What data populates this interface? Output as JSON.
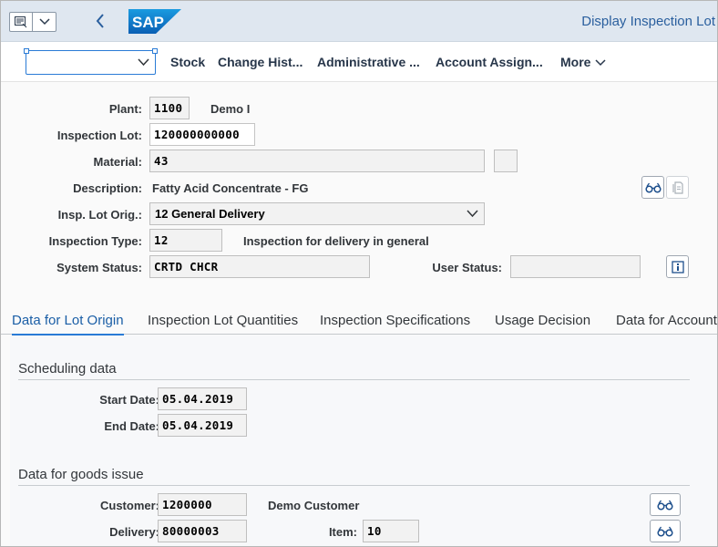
{
  "shell": {
    "title": "Display Inspection Lot",
    "logo_text": "SAP",
    "menu_icon": "menu-icon",
    "dropdown_icon": "chevron-down-icon",
    "back_icon": "back-icon"
  },
  "toolbar": {
    "command_field_value": "",
    "stock_label": "Stock",
    "change_history_label": "Change Hist...",
    "administrative_label": "Administrative ...",
    "account_assign_label": "Account Assign...",
    "more_label": "More"
  },
  "header": {
    "plant_label": "Plant:",
    "plant_value": "1100",
    "plant_desc": "Demo I",
    "inspection_lot_label": "Inspection Lot:",
    "inspection_lot_value": "120000000000",
    "material_label": "Material:",
    "material_value": "43",
    "description_label": "Description:",
    "description_value": "Fatty Acid Concentrate - FG",
    "insp_lot_origin_label": "Insp. Lot Orig.:",
    "insp_lot_origin_value": "12 General Delivery",
    "inspection_type_label": "Inspection Type:",
    "inspection_type_value": "12",
    "inspection_type_desc": "Inspection for delivery in general",
    "system_status_label": "System Status:",
    "system_status_value": "CRTD CHCR",
    "user_status_label": "User Status:",
    "user_status_value": ""
  },
  "tabs": [
    {
      "label": "Data for Lot Origin",
      "active": true
    },
    {
      "label": "Inspection Lot Quantities",
      "active": false
    },
    {
      "label": "Inspection Specifications",
      "active": false
    },
    {
      "label": "Usage Decision",
      "active": false
    },
    {
      "label": "Data for Account A",
      "active": false
    }
  ],
  "scheduling": {
    "title": "Scheduling data",
    "start_date_label": "Start Date:",
    "start_date_value": "05.04.2019",
    "end_date_label": "End Date:",
    "end_date_value": "05.04.2019"
  },
  "goods_issue": {
    "title": "Data for goods issue",
    "customer_label": "Customer:",
    "customer_value": "1200000",
    "customer_name": "Demo Customer",
    "delivery_label": "Delivery:",
    "delivery_value": "80000003",
    "item_label": "Item:",
    "item_value": "10"
  },
  "colors": {
    "shell_bg": "#dfe7f0",
    "accent": "#2a7bd6",
    "title": "#2a5f9e",
    "sap_logo_blue": "#1a73c8"
  }
}
